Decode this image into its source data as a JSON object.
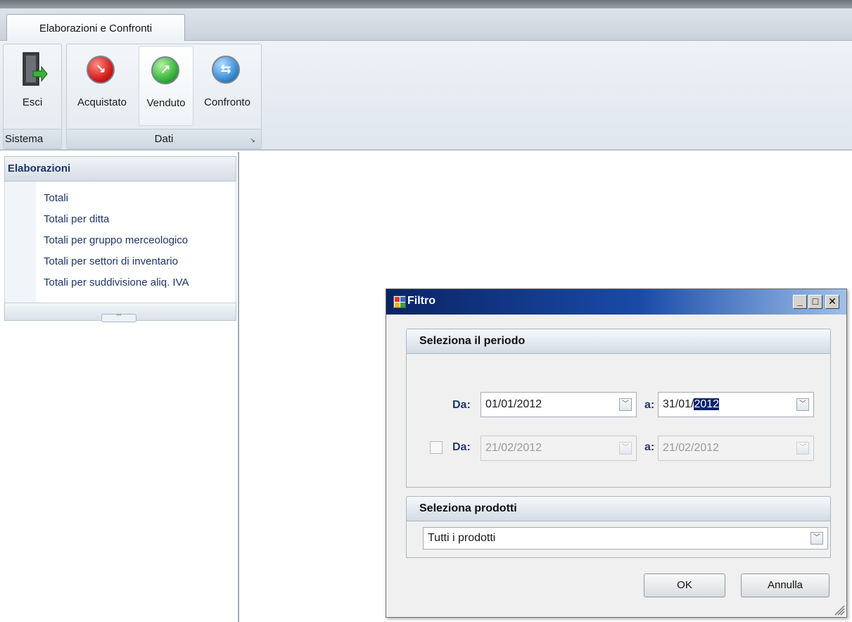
{
  "tab": {
    "label": "Elaborazioni e Confronti"
  },
  "ribbon": {
    "groups": [
      {
        "label": "Sistema"
      },
      {
        "label": "Dati"
      }
    ],
    "buttons": [
      {
        "label": "Esci",
        "icon": "exit-door-icon"
      },
      {
        "label": "Acquistato",
        "icon": "arrow-down-right-red-icon"
      },
      {
        "label": "Venduto",
        "icon": "arrow-up-right-green-icon"
      },
      {
        "label": "Confronto",
        "icon": "compare-arrows-blue-icon"
      }
    ]
  },
  "elaborazioni": {
    "title": "Elaborazioni",
    "items": [
      "Totali",
      "Totali per ditta",
      "Totali per gruppo merceologico",
      "Totali per settori di inventario",
      "Totali per suddivisione aliq. IVA"
    ]
  },
  "dialog": {
    "title": "Filtro",
    "periodo": {
      "title": "Seleziona il periodo",
      "row1": {
        "from_label": "Da:",
        "from_value": "01/01/2012",
        "to_label": "a:",
        "to_prefix": "31/01/",
        "to_selected": "2012"
      },
      "row2": {
        "from_label": "Da:",
        "from_value": "21/02/2012",
        "to_label": "a:",
        "to_value": "21/02/2012",
        "checked": false
      }
    },
    "prodotti": {
      "title": "Seleziona prodotti",
      "value": "Tutti i prodotti"
    },
    "ok_label": "OK",
    "cancel_label": "Annulla"
  },
  "colors": {
    "title_bar_start": "#0a2464",
    "title_bar_end": "#9fc0ea",
    "label_blue": "#1f3567",
    "selection": "#0a246a"
  }
}
